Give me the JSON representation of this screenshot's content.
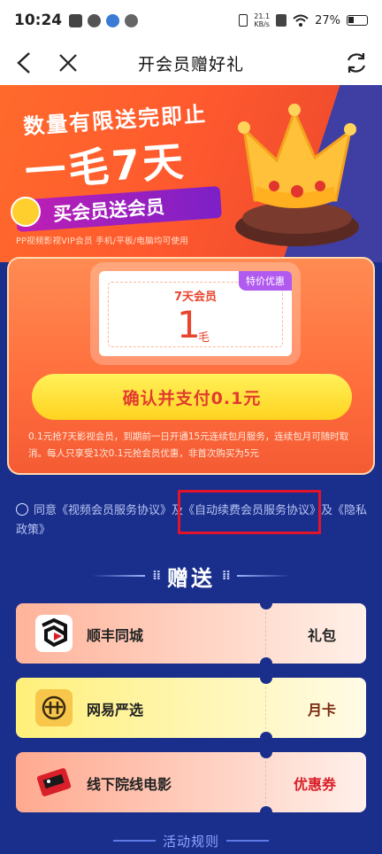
{
  "status": {
    "time": "10:24",
    "net_speed": "21.1\nKB/s",
    "battery": "27%"
  },
  "nav": {
    "title": "开会员赠好礼"
  },
  "banner": {
    "line1": "数量有限送完即止",
    "line2": "一毛7天",
    "tag": "买会员送会员",
    "note": "PP视频影视VIP会员 手机/平板/电脑均可使用"
  },
  "offer": {
    "badge": "特价优惠",
    "name": "7天会员",
    "amount": "1",
    "unit": "毛",
    "pay_button": "确认并支付0.1元",
    "desc": "0.1元抢7天影视会员，到期前一日开通15元连续包月服务，连续包月可随时取消。每人只享受1次0.1元抢会员优惠，非首次购买为5元"
  },
  "agreement": {
    "text": "同意《视频会员服务协议》及《自动续费会员服务协议》及《隐私政策》"
  },
  "gift": {
    "heading": "赠送",
    "items": [
      {
        "name": "顺丰同城",
        "kind": "礼包"
      },
      {
        "name": "网易严选",
        "kind": "月卡"
      },
      {
        "name": "线下院线电影",
        "kind": "优惠券"
      }
    ]
  },
  "rules": {
    "label": "活动规则"
  },
  "colors": {
    "brand_orange": "#ff6a2b",
    "bg_blue": "#1a2f8c",
    "pay_yellow": "#ffd31f",
    "highlight_red": "#e0142b"
  }
}
